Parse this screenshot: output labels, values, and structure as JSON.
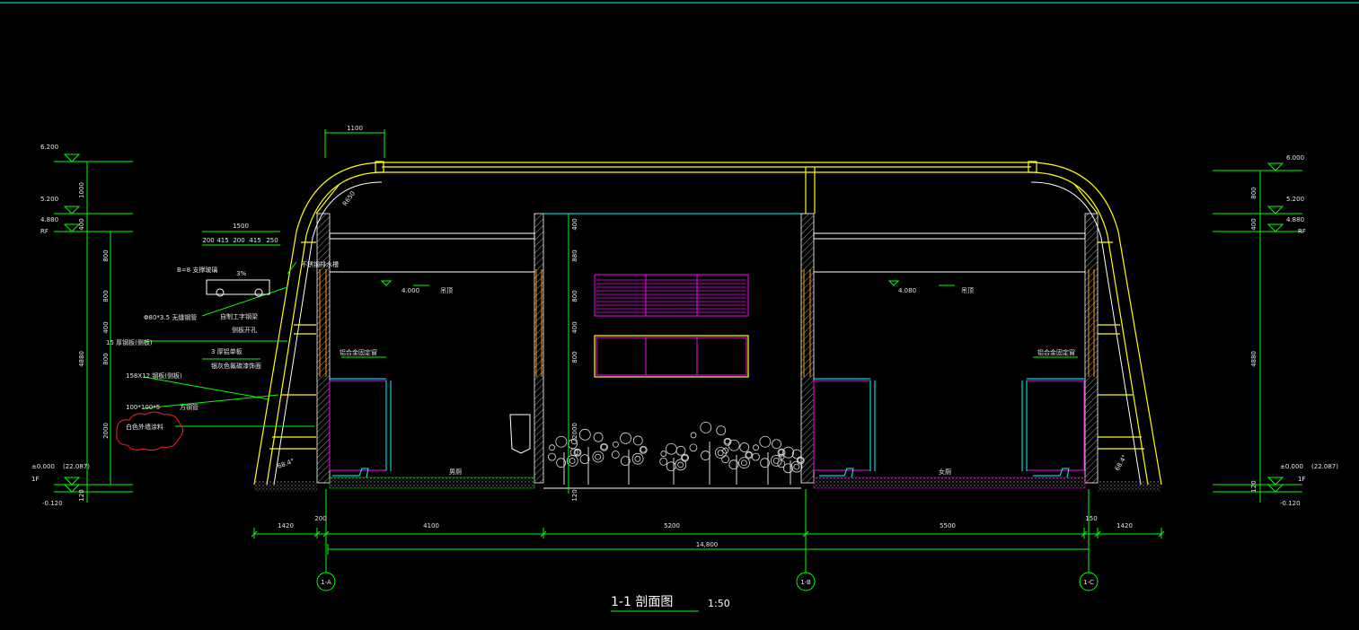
{
  "title": {
    "name": "1-1 剖面图",
    "scale": "1:50"
  },
  "colors": {
    "background": "#000000",
    "dim": "#00ff00",
    "outline": "#ffff00",
    "text": "#e6e6e6",
    "accent_magenta": "#ff00ff",
    "glass": "#00ffff",
    "cloud": "#ff2020"
  },
  "axes": [
    "1-A",
    "1-B",
    "1-C"
  ],
  "dimensions": {
    "bottom_segments": [
      "1420",
      "4100",
      "5200",
      "5500",
      "1420"
    ],
    "bottom_small": [
      "200",
      "150"
    ],
    "total": "14,800",
    "top_width": "1100",
    "radius": "R650",
    "roof_detail": [
      "1500",
      "200",
      "415",
      "200",
      "415",
      "250"
    ],
    "left_vertical": [
      "1000",
      "400",
      "800",
      "800",
      "400",
      "800",
      "2000",
      "120"
    ],
    "left_vertical_total": "4880",
    "right_vertical": [
      "800",
      "400",
      "4880",
      "120"
    ],
    "center_vertical": [
      "400",
      "880",
      "800",
      "400",
      "800",
      "2000",
      "120"
    ]
  },
  "levels": {
    "left": [
      "6.200",
      "5.200",
      "4.880",
      "RF",
      "±0.000",
      "(22.087)",
      "1F",
      "-0.120"
    ],
    "right": [
      "6.000",
      "5.200",
      "4.880",
      "RF",
      "±0.000",
      "(22.087)",
      "1F",
      "-0.120"
    ],
    "ceiling": [
      "4.000",
      "4.080"
    ]
  },
  "annotations": {
    "roof_label": "不锈钢排水槽",
    "roof_pipe": "B=8  支撑玻璃",
    "slope": "3%",
    "p1": "Φ80*3.5  无缝钢管",
    "p2": "自制工字钢梁",
    "p3": "侧板开孔",
    "p4": "15 厚钢板(侧板)",
    "p5": "3 厚铝单板",
    "p6": "银灰色氟碳漆饰面",
    "p7": "158X12  钢板(侧板)",
    "p8": "100*100*5",
    "p9": "方钢管",
    "cloud_text": "白色外墙涂料",
    "ceiling_label": "吊顶",
    "window_left": "铝合金固定窗",
    "window_right": "铝合金固定窗",
    "room_left": "男厕",
    "room_right": "女厕",
    "angle_left": "68.4°",
    "angle_right": "68.4°"
  }
}
